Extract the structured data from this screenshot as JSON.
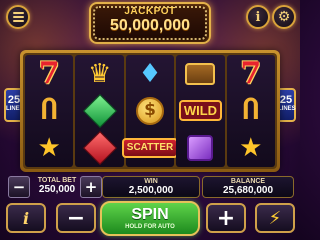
{
  "colors": {
    "accent_gold": "#e4b24a",
    "spin_green": "#3fb836",
    "background": "#2a0a3a"
  },
  "top_bar": {
    "menu_icon": "hamburger-icon",
    "info_label": "i",
    "settings_icon": "gear-icon"
  },
  "jackpot": {
    "label": "JACKPOT",
    "value": "50,000,000"
  },
  "lines": {
    "left_count": "25",
    "right_count": "25",
    "label": "LINES"
  },
  "reels": [
    [
      "seven",
      "horseshoe",
      "star"
    ],
    [
      "crown",
      "emerald",
      "ruby"
    ],
    [
      "diamond",
      "coin",
      "scatter"
    ],
    [
      "chest",
      "wild",
      "amethyst"
    ],
    [
      "seven",
      "horseshoe",
      "star"
    ]
  ],
  "symbols": {
    "wild_text": "WILD",
    "scatter_text": "SCATTER",
    "coin_text": "$",
    "seven_text": "7"
  },
  "info": {
    "total_bet_label": "TOTAL BET",
    "total_bet_value": "250,000",
    "win_label": "WIN",
    "win_value": "2,500,000",
    "balance_label": "BALANCE",
    "balance_value": "25,680,000",
    "bet_minus": "−",
    "bet_plus": "+"
  },
  "bottom_bar": {
    "paytable_label": "i",
    "minus_label": "−",
    "spin_label": "SPIN",
    "spin_sub": "HOLD FOR AUTO",
    "plus_label": "+",
    "turbo_icon": "lightning-icon"
  }
}
